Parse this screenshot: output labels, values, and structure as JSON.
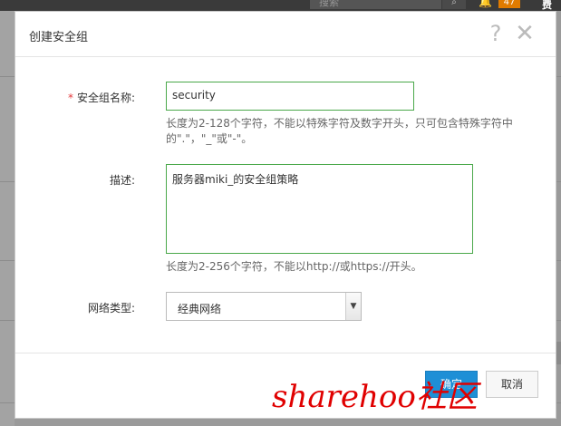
{
  "background": {
    "search_placeholder": "搜索",
    "notification_count": "47",
    "fee_label": "费用"
  },
  "dialog": {
    "title": "创建安全组",
    "help_label": "?",
    "close_label": "✕"
  },
  "form": {
    "name": {
      "label": "安全组名称:",
      "required_mark": "*",
      "value": "security",
      "hint": "长度为2-128个字符，不能以特殊字符及数字开头，只可包含特殊字符中的\".\"，\"_\"或\"-\"。"
    },
    "description": {
      "label": "描述:",
      "value": "服务器miki_的安全组策略",
      "hint": "长度为2-256个字符，不能以http://或https://开头。"
    },
    "network_type": {
      "label": "网络类型:",
      "selected": "经典网络"
    }
  },
  "buttons": {
    "ok": "确定",
    "cancel": "取消"
  },
  "watermark": "sharehoo社区",
  "colors": {
    "accent": "#1e8fd6",
    "input_border_focus": "#4aa84a",
    "required": "#e4393c",
    "watermark": "#e00000"
  }
}
